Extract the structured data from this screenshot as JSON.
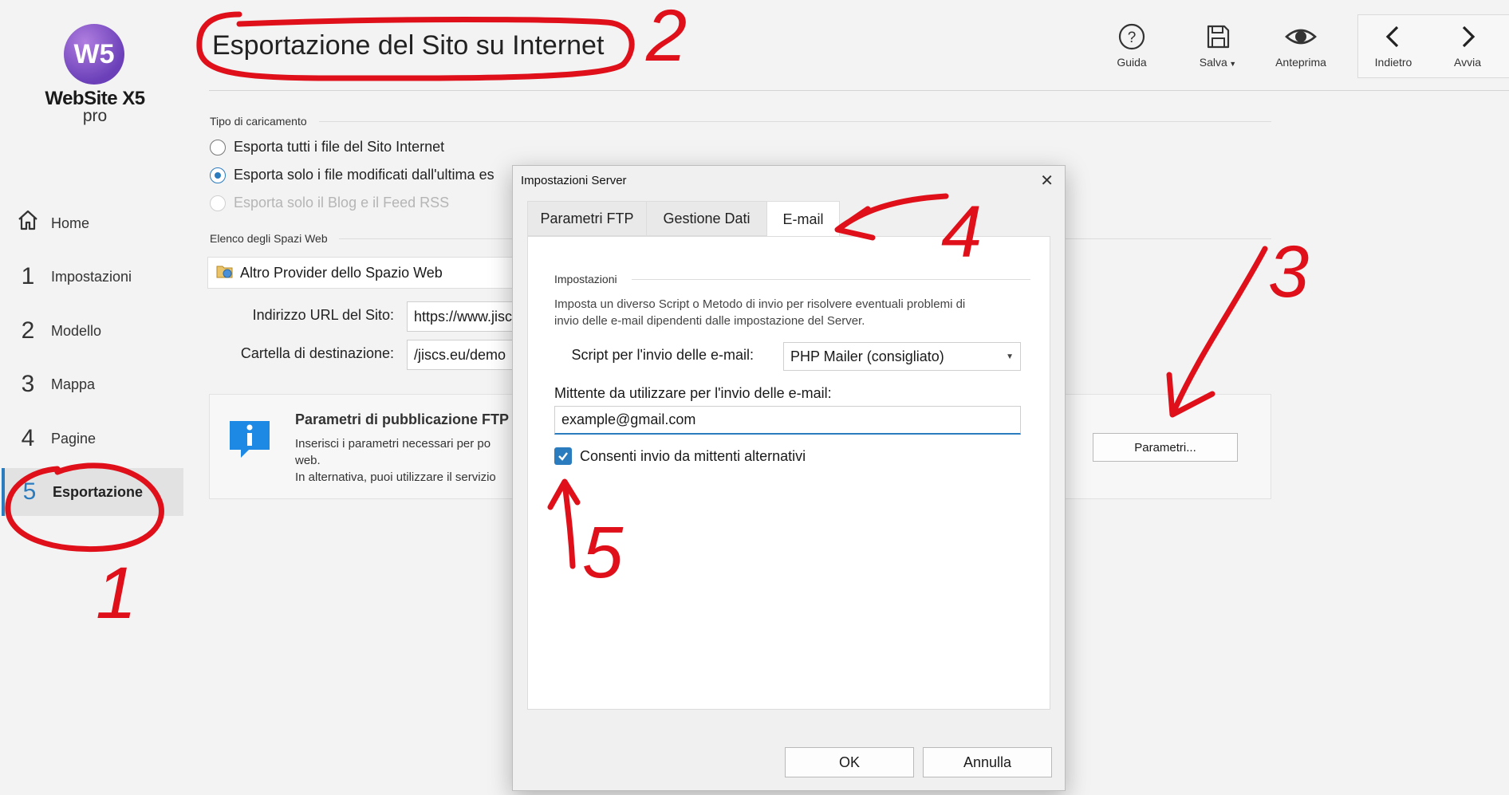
{
  "app": {
    "logo_mark": "W5",
    "logo_name": "WebSite X5",
    "logo_edition": "pro"
  },
  "sidebar": {
    "items": [
      {
        "number": "",
        "label": "Home",
        "icon": "home-icon"
      },
      {
        "number": "1",
        "label": "Impostazioni"
      },
      {
        "number": "2",
        "label": "Modello"
      },
      {
        "number": "3",
        "label": "Mappa"
      },
      {
        "number": "4",
        "label": "Pagine"
      },
      {
        "number": "5",
        "label": "Esportazione",
        "active": true
      }
    ]
  },
  "header": {
    "title": "Esportazione del Sito su Internet",
    "toolbar": {
      "help": "Guida",
      "save": "Salva",
      "preview": "Anteprima",
      "back": "Indietro",
      "next": "Avvia"
    }
  },
  "upload": {
    "section_label": "Tipo di caricamento",
    "options": [
      {
        "label": "Esporta tutti i file del Sito Internet",
        "checked": false
      },
      {
        "label": "Esporta solo i file modificati dall'ultima es",
        "checked": true
      },
      {
        "label": "Esporta solo il Blog e il Feed RSS",
        "disabled": true
      }
    ]
  },
  "spaces": {
    "section_label": "Elenco degli Spazi Web",
    "provider": "Altro Provider dello Spazio Web",
    "url_label": "Indirizzo URL del Sito:",
    "url_value": "https://www.jisc",
    "folder_label": "Cartella di destinazione:",
    "folder_value": "/jiscs.eu/demo"
  },
  "ftp_panel": {
    "title": "Parametri di pubblicazione FTP",
    "line1": "Inserisci i parametri necessari per po",
    "line2": "web.",
    "line3": "In alternativa, puoi utilizzare il servizio",
    "button": "Parametri..."
  },
  "dialog": {
    "title": "Impostazioni Server",
    "tabs": [
      {
        "label": "Parametri FTP"
      },
      {
        "label": "Gestione Dati"
      },
      {
        "label": "E-mail",
        "active": true
      }
    ],
    "section_label": "Impostazioni",
    "description_line1": "Imposta un diverso Script o Metodo di invio per risolvere eventuali problemi di",
    "description_line2": "invio delle e-mail dipendenti dalle impostazione del Server.",
    "script_label": "Script per l'invio delle e-mail:",
    "script_value": "PHP Mailer (consigliato)",
    "sender_label": "Mittente da utilizzare per l'invio delle e-mail:",
    "sender_value": "example@gmail.com",
    "checkbox_label": "Consenti invio da mittenti alternativi",
    "checkbox_checked": true,
    "ok": "OK",
    "cancel": "Annulla"
  },
  "annotations": {
    "color": "#e0101a",
    "numbers": [
      "1",
      "2",
      "3",
      "4",
      "5"
    ]
  }
}
